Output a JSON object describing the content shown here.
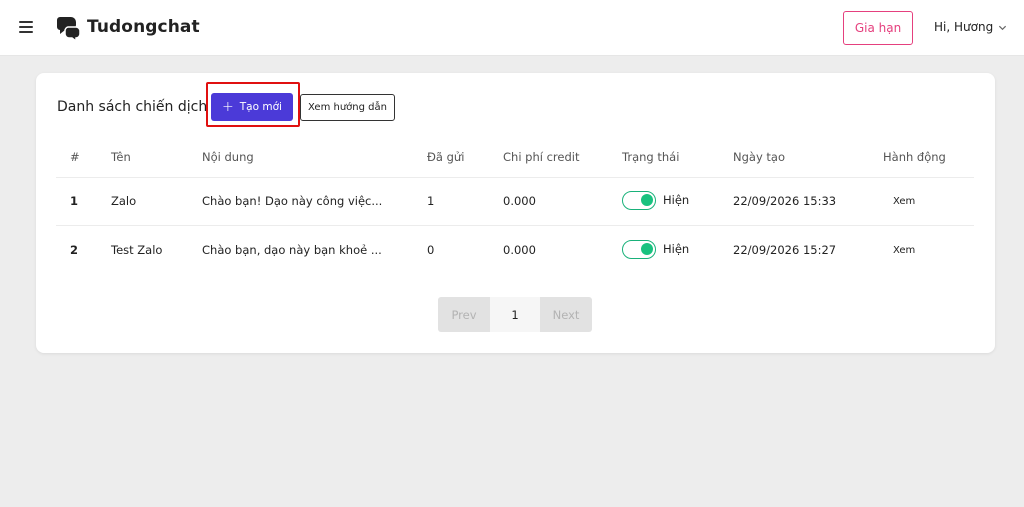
{
  "header": {
    "brand": "Tudongchat",
    "renew_label": "Gia hạn",
    "user_greeting": "Hi, Hương"
  },
  "campaigns": {
    "title": "Danh sách chiến dịch",
    "create_label": "Tạo mới",
    "guide_label": "Xem hướng dẫn",
    "columns": [
      "#",
      "Tên",
      "Nội dung",
      "Đã gửi",
      "Chi phí credit",
      "Trạng thái",
      "Ngày tạo",
      "Hành động"
    ],
    "rows": [
      {
        "index": "1",
        "name": "Zalo",
        "content": "Chào bạn! Dạo này công việc...",
        "sent": "1",
        "cost": "0.000",
        "status": "Hiện",
        "status_on": true,
        "created": "22/09/2026 15:33",
        "action": "Xem"
      },
      {
        "index": "2",
        "name": "Test Zalo",
        "content": "Chào bạn, dạo này bạn khoẻ ...",
        "sent": "0",
        "cost": "0.000",
        "status": "Hiện",
        "status_on": true,
        "created": "22/09/2026 15:27",
        "action": "Xem"
      }
    ]
  },
  "pagination": {
    "prev": "Prev",
    "current": "1",
    "next": "Next"
  },
  "colors": {
    "primary": "#4b3ad8",
    "accent_pink": "#e5407e",
    "toggle_green": "#19c27f",
    "highlight_red": "#e01010"
  },
  "icons": {
    "menu": "hamburger-menu-icon",
    "logo": "chat-bubble-logo-icon",
    "dropdown": "chevron-down-icon",
    "add": "plus-icon"
  }
}
